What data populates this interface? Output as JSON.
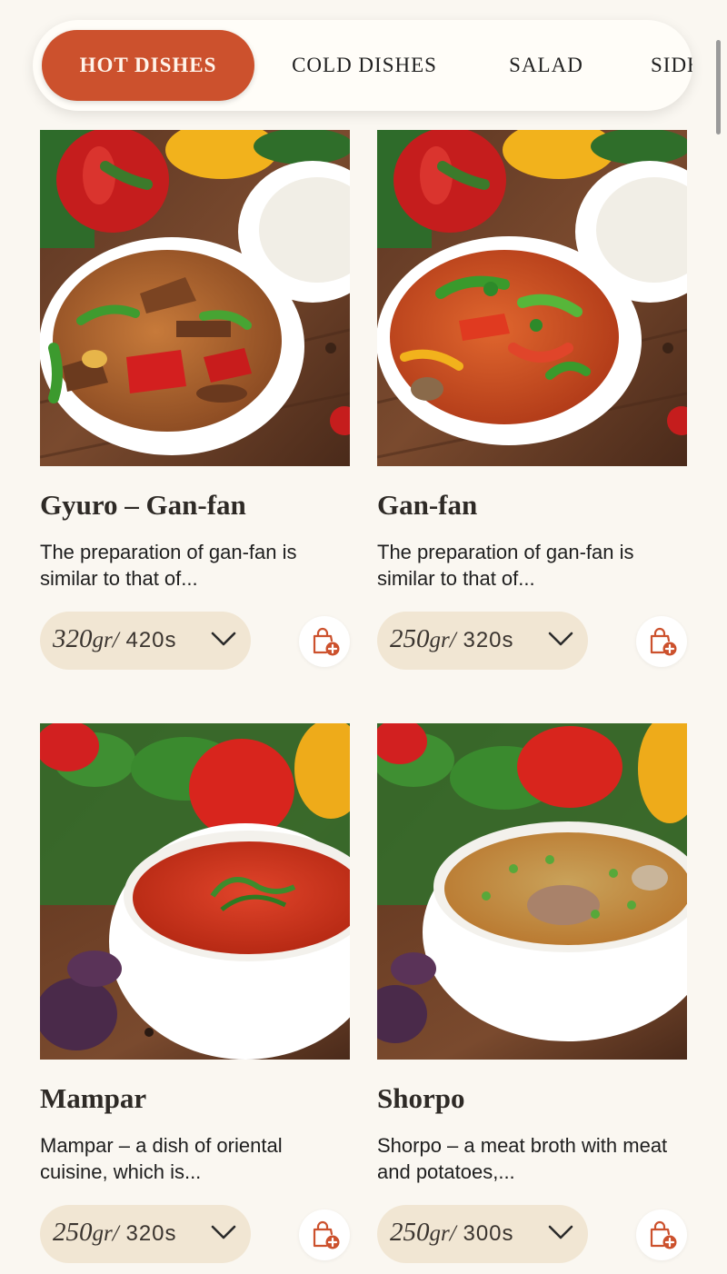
{
  "tabs": [
    {
      "label": "HOT DISHES",
      "active": true
    },
    {
      "label": "COLD DISHES",
      "active": false
    },
    {
      "label": "SALAD",
      "active": false
    },
    {
      "label": "SIDE",
      "active": false
    }
  ],
  "dishes": [
    {
      "title": "Gyuro – Gan-fan",
      "description": "The preparation of gan-fan is similar to that of...",
      "weight": "320",
      "weight_unit": "gr/",
      "time": "420s",
      "image": "stir-fried-beef-with-peppers"
    },
    {
      "title": "Gan-fan",
      "description": "The preparation of gan-fan is similar to that of...",
      "weight": "250",
      "weight_unit": "gr/",
      "time": "320s",
      "image": "vegetable-stir-fry-with-peppers"
    },
    {
      "title": "Mampar",
      "description": "Mampar – a dish of oriental cuisine, which is...",
      "weight": "250",
      "weight_unit": "gr/",
      "time": "320s",
      "image": "red-tomato-soup-with-herbs"
    },
    {
      "title": "Shorpo",
      "description": "Shorpo – a meat broth with meat and potatoes,...",
      "weight": "250",
      "weight_unit": "gr/",
      "time": "300s",
      "image": "clear-meat-broth-with-green-onion"
    }
  ],
  "icons": {
    "weight_dropdown": "chevron-down-icon",
    "add_to_cart": "shopping-bag-plus-icon"
  },
  "colors": {
    "accent": "#cc512d",
    "pill_background": "#f1e6d3",
    "page_background": "#faf7f1"
  }
}
